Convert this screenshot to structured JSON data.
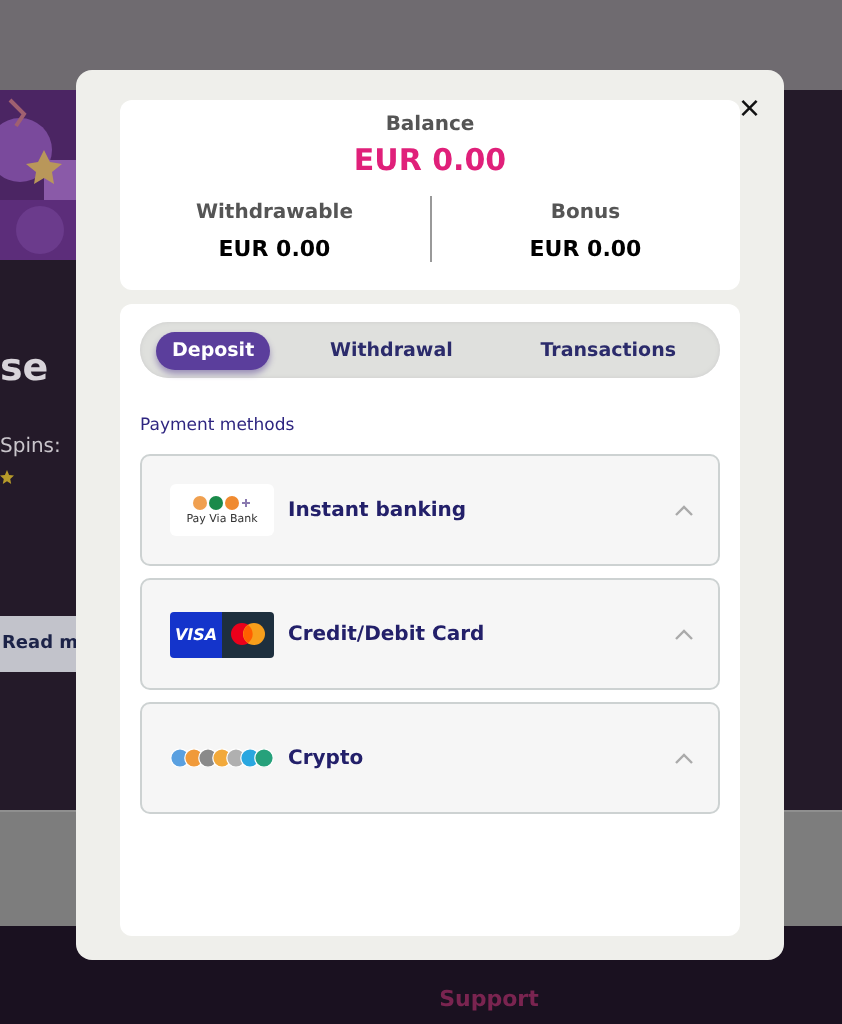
{
  "background": {
    "heading": "se",
    "text": "Spins:",
    "button": "Read m",
    "footer_link": "Support"
  },
  "modal": {
    "close": "×",
    "balance": {
      "label": "Balance",
      "value": "EUR 0.00"
    },
    "sub_balances": [
      {
        "label": "Withdrawable",
        "value": "EUR 0.00"
      },
      {
        "label": "Bonus",
        "value": "EUR 0.00"
      }
    ],
    "tabs": [
      {
        "label": "Deposit",
        "selected": true
      },
      {
        "label": "Withdrawal",
        "selected": false
      },
      {
        "label": "Transactions",
        "selected": false
      }
    ],
    "section_title": "Payment methods",
    "payment_methods": [
      {
        "kind": "bank",
        "logo_text": "Pay Via Bank",
        "name": "Instant banking"
      },
      {
        "kind": "card",
        "logo_text": "VISA",
        "name": "Credit/Debit Card"
      },
      {
        "kind": "crypto",
        "name": "Crypto"
      }
    ]
  }
}
